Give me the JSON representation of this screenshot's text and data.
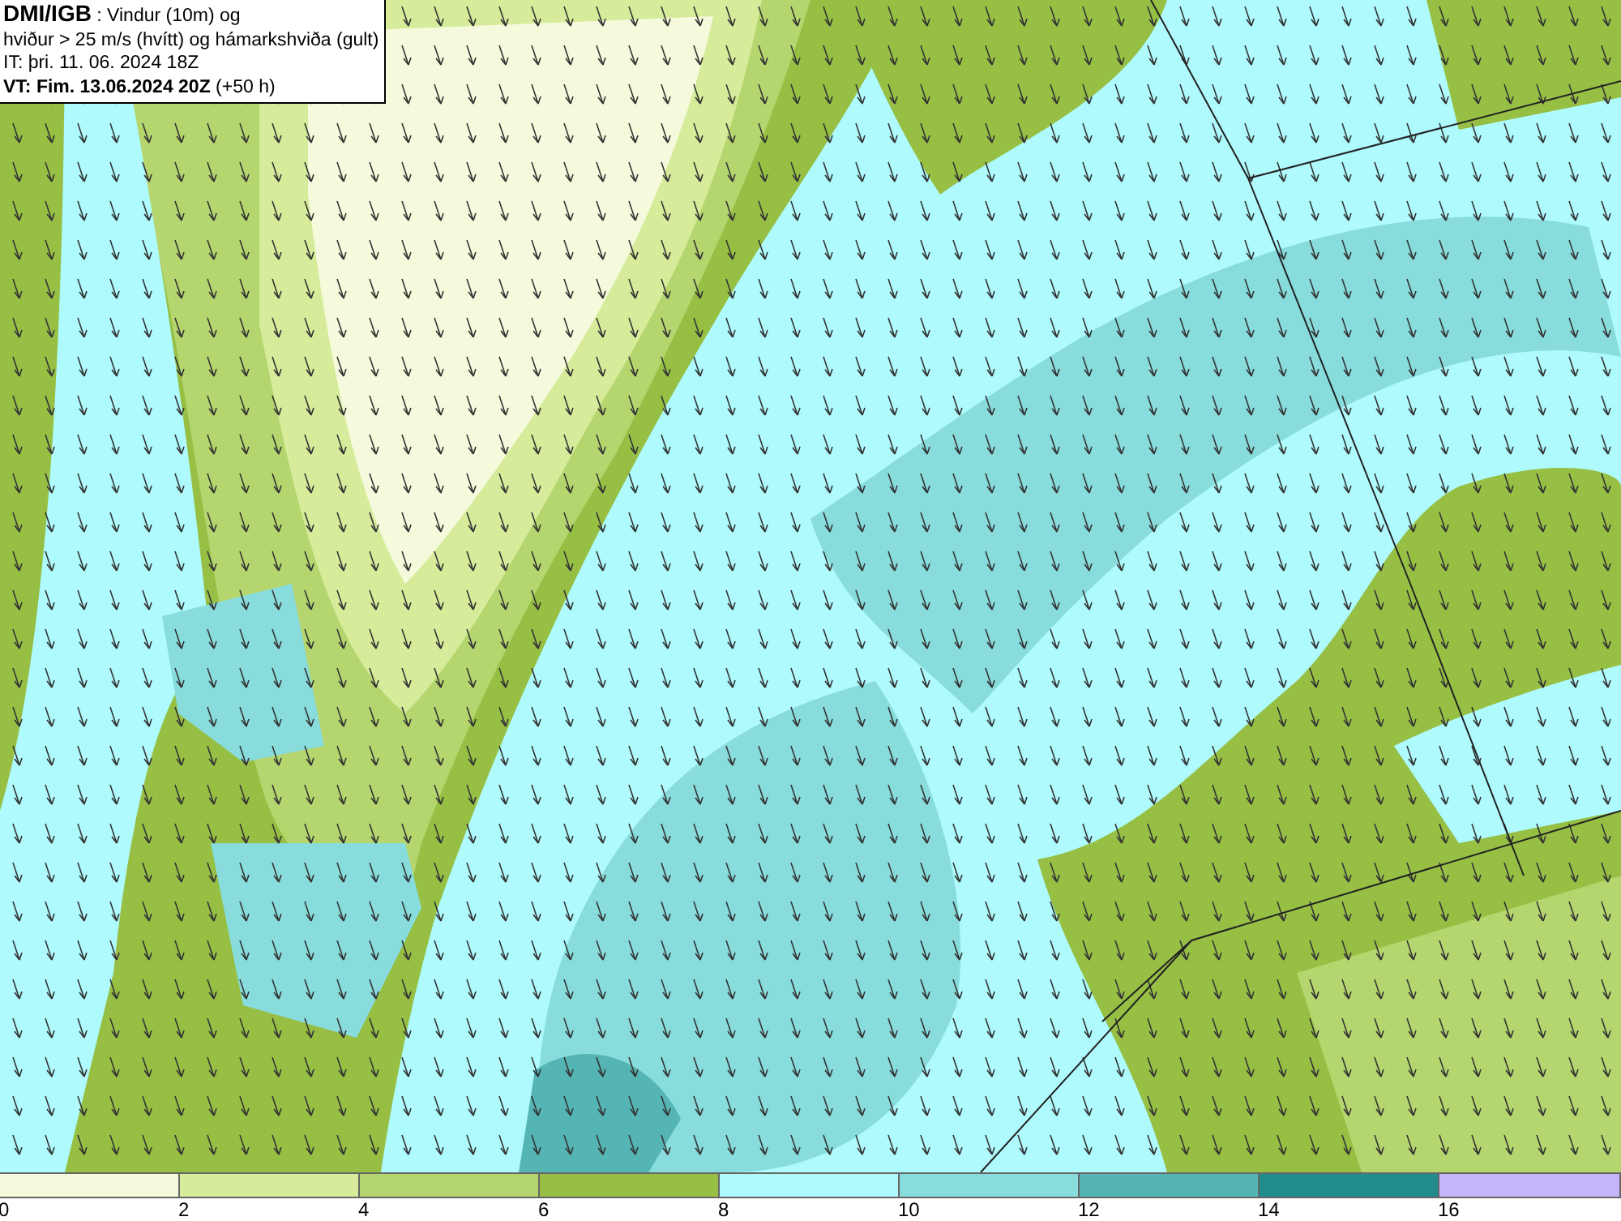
{
  "header": {
    "lines": [
      "**DMI/IGB** : Vindur (10m) og",
      "hviður > 25 m/s (hvítt) og hámarkshviða (gult)",
      "IT: þri. 11. 06. 2024 18Z",
      "**VT: Fim. 13.06.2024 20Z** (+50 h)"
    ]
  },
  "legend": {
    "bins": [
      {
        "color": "#f5fadc"
      },
      {
        "color": "#d6ec9a"
      },
      {
        "color": "#b5d66e"
      },
      {
        "color": "#96bf44"
      },
      {
        "color": "#aefafc"
      },
      {
        "color": "#88dcdc"
      },
      {
        "color": "#55b4b4"
      },
      {
        "color": "#228c8c"
      },
      {
        "color": "#c4b4fa"
      }
    ],
    "ticks": [
      "0",
      "2",
      "4",
      "6",
      "8",
      "10",
      "12",
      "14",
      "16"
    ]
  }
}
